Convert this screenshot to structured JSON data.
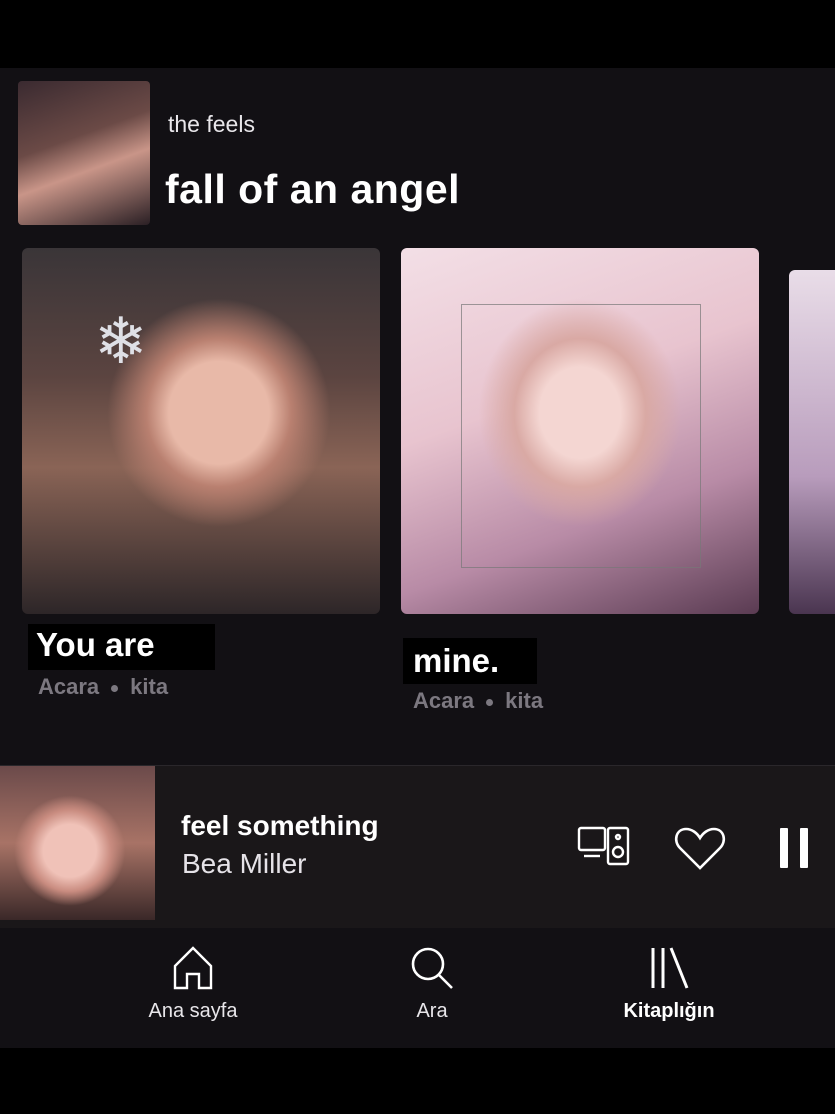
{
  "header": {
    "subtitle": "the feels",
    "title": "fall of an angel"
  },
  "cards": [
    {
      "label": "You are",
      "meta_a": "Acara",
      "meta_b": "kita"
    },
    {
      "label": "mine.",
      "meta_a": "Acara",
      "meta_b": "kita"
    }
  ],
  "player": {
    "title": "feel something",
    "artist": "Bea Miller",
    "icons": [
      "devices-icon",
      "heart-icon",
      "pause-icon"
    ]
  },
  "nav": {
    "items": [
      {
        "label": "Ana sayfa",
        "icon": "home-icon"
      },
      {
        "label": "Ara",
        "icon": "search-icon"
      },
      {
        "label": "Kitaplığın",
        "icon": "library-icon"
      }
    ]
  },
  "colors": {
    "background": "#121014",
    "text": "#ffffff",
    "muted": "#7c7880"
  }
}
